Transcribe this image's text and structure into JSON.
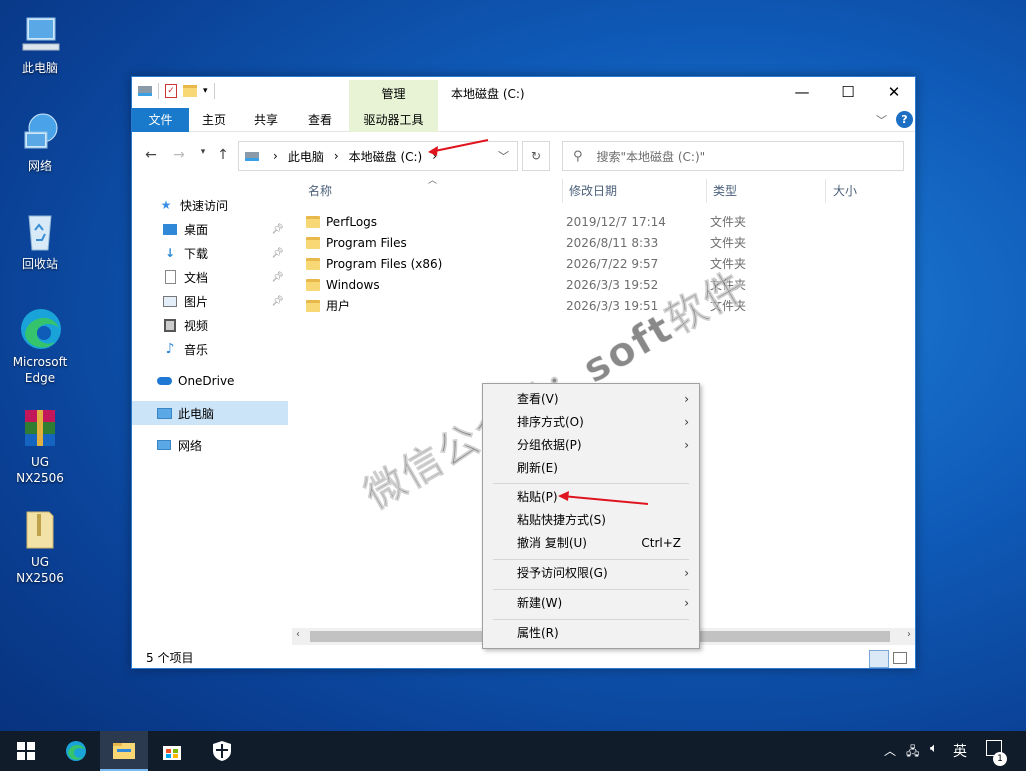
{
  "desktop": {
    "icons": [
      {
        "label": "此电脑",
        "icon": "computer-icon"
      },
      {
        "label": "网络",
        "icon": "network-icon"
      },
      {
        "label": "回收站",
        "icon": "recycle-bin-icon"
      },
      {
        "label": "Microsoft Edge",
        "icon": "edge-icon"
      },
      {
        "label": "UG NX2506",
        "icon": "winrar-icon"
      },
      {
        "label": "UG NX2506",
        "icon": "folder-zip-icon"
      }
    ]
  },
  "window": {
    "manage_tab": "管理",
    "title": "本地磁盘 (C:)",
    "controls": {
      "minimize": "—",
      "maximize": "☐",
      "close": "✕"
    },
    "ribbon_tabs": [
      "文件",
      "主页",
      "共享",
      "查看"
    ],
    "driver_tools_tab": "驱动器工具",
    "address": {
      "crumbs": [
        "此电脑",
        "本地磁盘 (C:)"
      ]
    },
    "search_placeholder": "搜索\"本地磁盘 (C:)\"",
    "nav": {
      "quick_access": "快速访问",
      "items": [
        "桌面",
        "下载",
        "文档",
        "图片",
        "视频",
        "音乐"
      ],
      "onedrive": "OneDrive",
      "this_pc": "此电脑",
      "network": "网络"
    },
    "columns": {
      "name": "名称",
      "modified": "修改日期",
      "type": "类型",
      "size": "大小"
    },
    "files": [
      {
        "name": "PerfLogs",
        "date": "2019/12/7 17:14",
        "type": "文件夹"
      },
      {
        "name": "Program Files",
        "date": "2026/8/11 8:33",
        "type": "文件夹"
      },
      {
        "name": "Program Files (x86)",
        "date": "2026/7/22 9:57",
        "type": "文件夹"
      },
      {
        "name": "Windows",
        "date": "2026/3/3 19:52",
        "type": "文件夹"
      },
      {
        "name": "用户",
        "date": "2026/3/3 19:51",
        "type": "文件夹"
      }
    ],
    "status": "5 个项目"
  },
  "context_menu": {
    "view": "查看(V)",
    "sort": "排序方式(O)",
    "group": "分组依据(P)",
    "refresh": "刷新(E)",
    "paste": "粘贴(P)",
    "paste_shortcut": "粘贴快捷方式(S)",
    "undo": "撤消 复制(U)",
    "undo_shortcut": "Ctrl+Z",
    "grant_access": "授予访问权限(G)",
    "new": "新建(W)",
    "properties": "属性(R)"
  },
  "watermark": "微信公众号：soft软件",
  "taskbar": {
    "lang": "英",
    "notification_count": "1"
  },
  "colors": {
    "accent": "#1979ca",
    "manage_bg": "#e8f3d5",
    "selected": "#cce4f7",
    "arrow": "#e0141e"
  }
}
